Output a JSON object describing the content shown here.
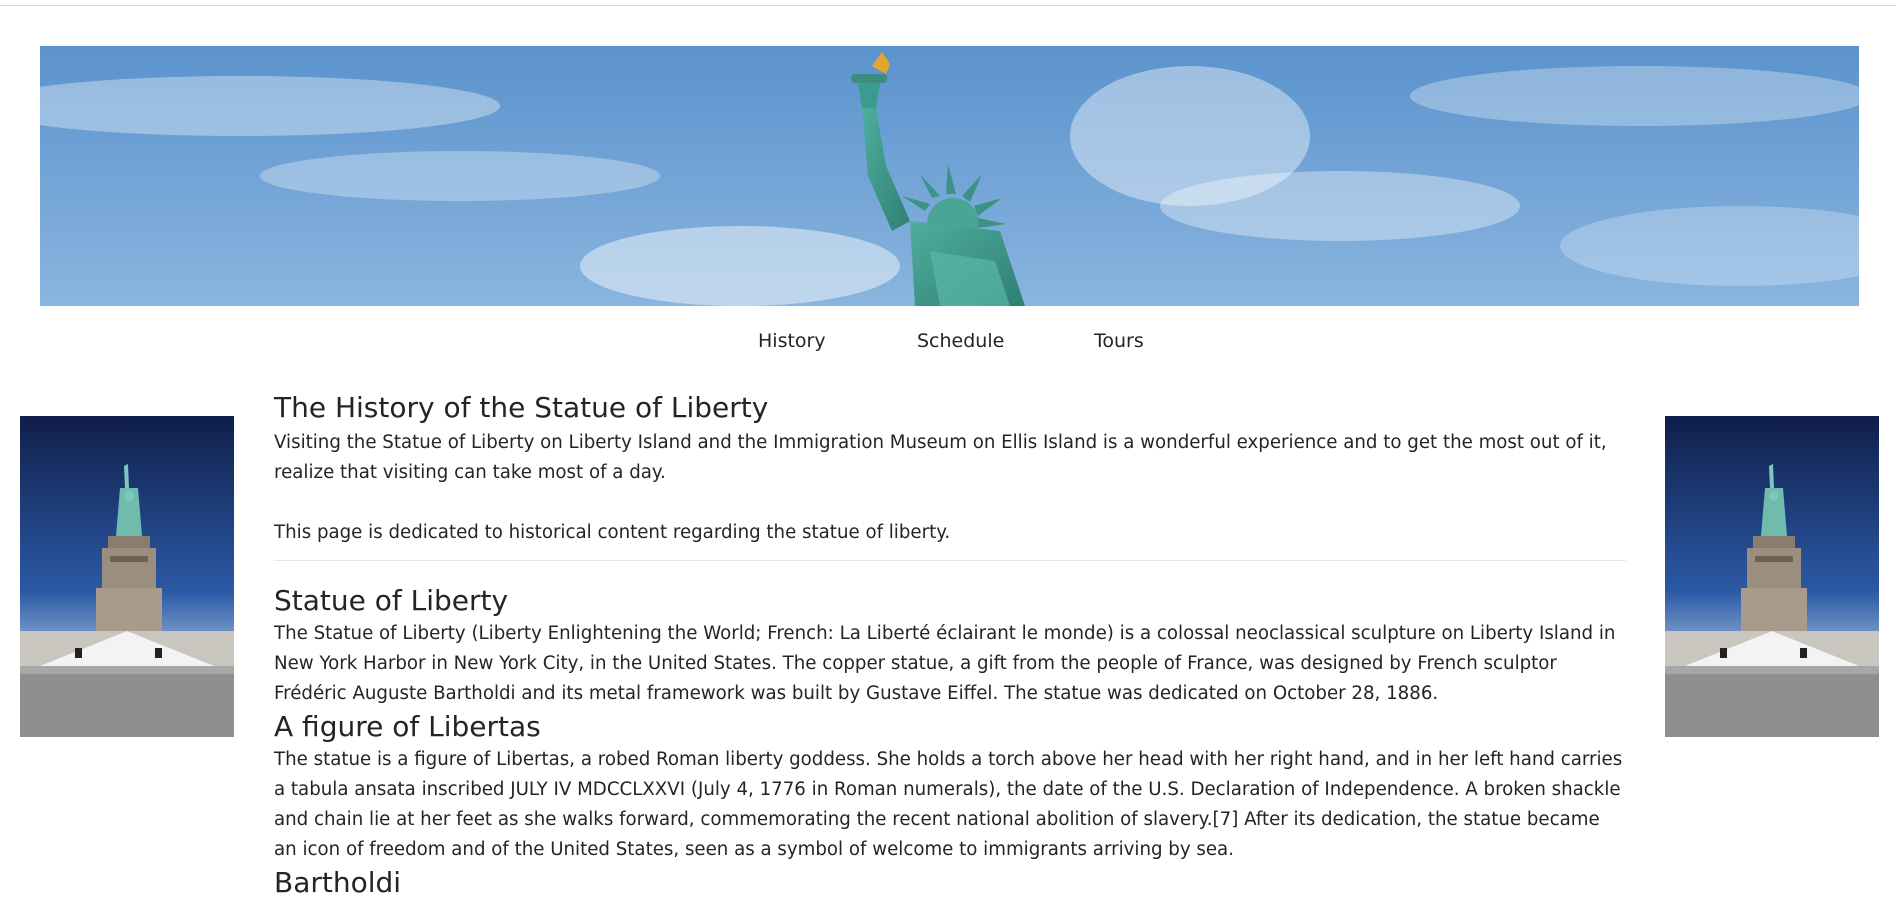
{
  "nav": {
    "items": [
      {
        "label": "History"
      },
      {
        "label": "Schedule"
      },
      {
        "label": "Tours"
      }
    ]
  },
  "intro": {
    "title": "The History of the Statue of Liberty",
    "paragraph1": "Visiting the Statue of Liberty on Liberty Island and the Immigration Museum on Ellis Island is a wonderful experience and to get the most out of it, realize that visiting can take most of a day.",
    "paragraph2": "This page is dedicated to historical content regarding the statue of liberty."
  },
  "sections": [
    {
      "heading": "Statue of Liberty",
      "body": "The Statue of Liberty (Liberty Enlightening the World; French: La Liberté éclairant le monde) is a colossal neoclassical sculpture on Liberty Island in New York Harbor in New York City, in the United States. The copper statue, a gift from the people of France, was designed by French sculptor Frédéric Auguste Bartholdi and its metal framework was built by Gustave Eiffel. The statue was dedicated on October 28, 1886."
    },
    {
      "heading": "A figure of Libertas",
      "body": "The statue is a figure of Libertas, a robed Roman liberty goddess. She holds a torch above her head with her right hand, and in her left hand carries a tabula ansata inscribed JULY IV MDCCLXXVI (July 4, 1776 in Roman numerals), the date of the U.S. Declaration of Independence. A broken shackle and chain lie at her feet as she walks forward, commemorating the recent national abolition of slavery.[7] After its dedication, the statue became an icon of freedom and of the United States, seen as a symbol of welcome to immigrants arriving by sea."
    },
    {
      "heading": "Bartholdi"
    }
  ],
  "colors": {
    "sky": "#6d9fd3",
    "statue_green": "#3d9b8e",
    "text": "#212529"
  }
}
